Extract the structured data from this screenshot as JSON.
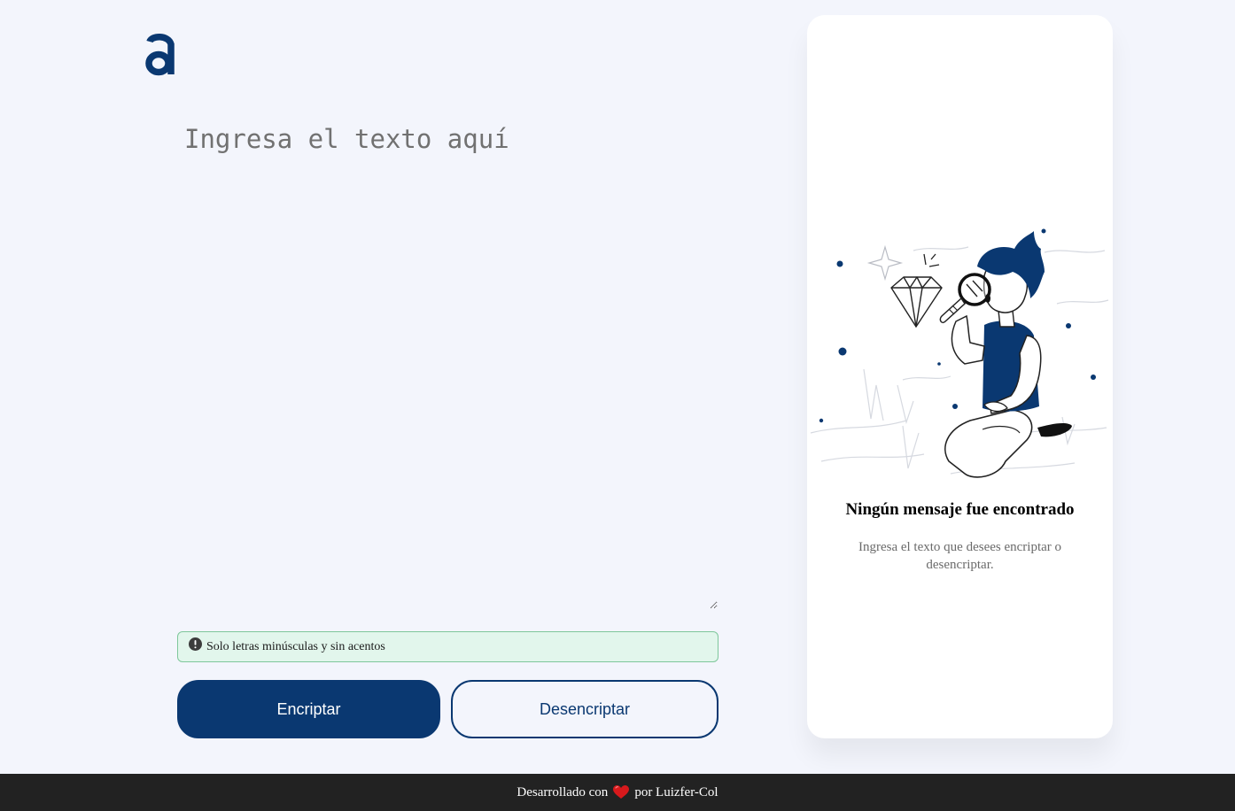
{
  "app": {
    "logo_icon": "alura-a-logo-icon",
    "accent_color": "#0A3871",
    "background_color": "#F3F5FC"
  },
  "editor": {
    "value": "",
    "placeholder": "Ingresa el texto aquí"
  },
  "hint": {
    "icon": "exclamation-circle-icon",
    "text": "Solo letras minúsculas y sin acentos",
    "background_color": "#E2F6EC",
    "border_color": "#7FC79B"
  },
  "buttons": {
    "encrypt_label": "Encriptar",
    "decrypt_label": "Desencriptar"
  },
  "result_panel": {
    "illustration": "person-with-magnifying-glass-and-diamond-illustration",
    "title": "Ningún mensaje fue encontrado",
    "description": "Ingresa el texto que desees encriptar o desencriptar."
  },
  "footer": {
    "prefix": "Desarrollado con",
    "icon": "heart-icon",
    "suffix": "por Luizfer-Col",
    "background_color": "#222222"
  }
}
